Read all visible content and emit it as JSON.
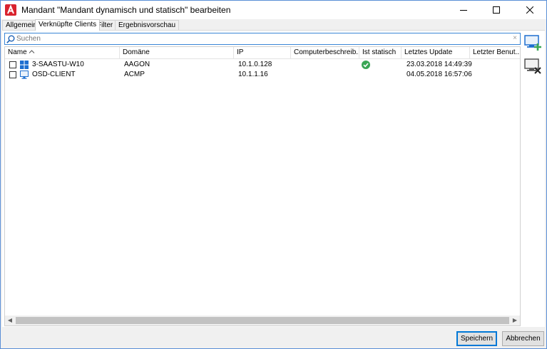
{
  "window": {
    "title": "Mandant \"Mandant dynamisch und statisch\" bearbeiten",
    "app_icon": "aagon-logo-icon",
    "controls": [
      "minimize-icon",
      "maximize-icon",
      "close-icon"
    ]
  },
  "tabs": [
    {
      "label": "Allgemein",
      "active": false
    },
    {
      "label": "Verknüpfte Clients",
      "active": true
    },
    {
      "label": "Filter",
      "active": false
    },
    {
      "label": "Ergebnisvorschau",
      "active": false
    }
  ],
  "search": {
    "placeholder": "Suchen",
    "value": "",
    "clear_symbol": "×"
  },
  "grid": {
    "columns": [
      "Name",
      "Domäne",
      "IP",
      "Computerbeschreib...",
      "Ist statisch",
      "Letztes Update",
      "Letzter Benut..."
    ],
    "sort_column": "Name",
    "sort_direction": "ascending",
    "rows": [
      {
        "checked": false,
        "icon": "windows-icon",
        "name": "3-SAASTU-W10",
        "domain": "AAGON",
        "ip": "10.1.0.128",
        "description": "",
        "is_static": true,
        "last_update": "23.03.2018 14:49:39",
        "last_user": ""
      },
      {
        "checked": false,
        "icon": "monitor-icon",
        "name": "OSD-CLIENT",
        "domain": "ACMP",
        "ip": "10.1.1.16",
        "description": "",
        "is_static": false,
        "last_update": "04.05.2018 16:57:06",
        "last_user": ""
      }
    ],
    "scroll_left_symbol": "◀",
    "scroll_right_symbol": "▶"
  },
  "side_actions": [
    {
      "icon": "add-client-icon",
      "label": "Client hinzufügen"
    },
    {
      "icon": "remove-client-icon",
      "label": "Client entfernen"
    }
  ],
  "footer": {
    "save_label": "Speichern",
    "cancel_label": "Abbrechen"
  },
  "colors": {
    "accent": "#0078d7",
    "static_ok": "#3aa655",
    "brand": "#d9232e"
  }
}
